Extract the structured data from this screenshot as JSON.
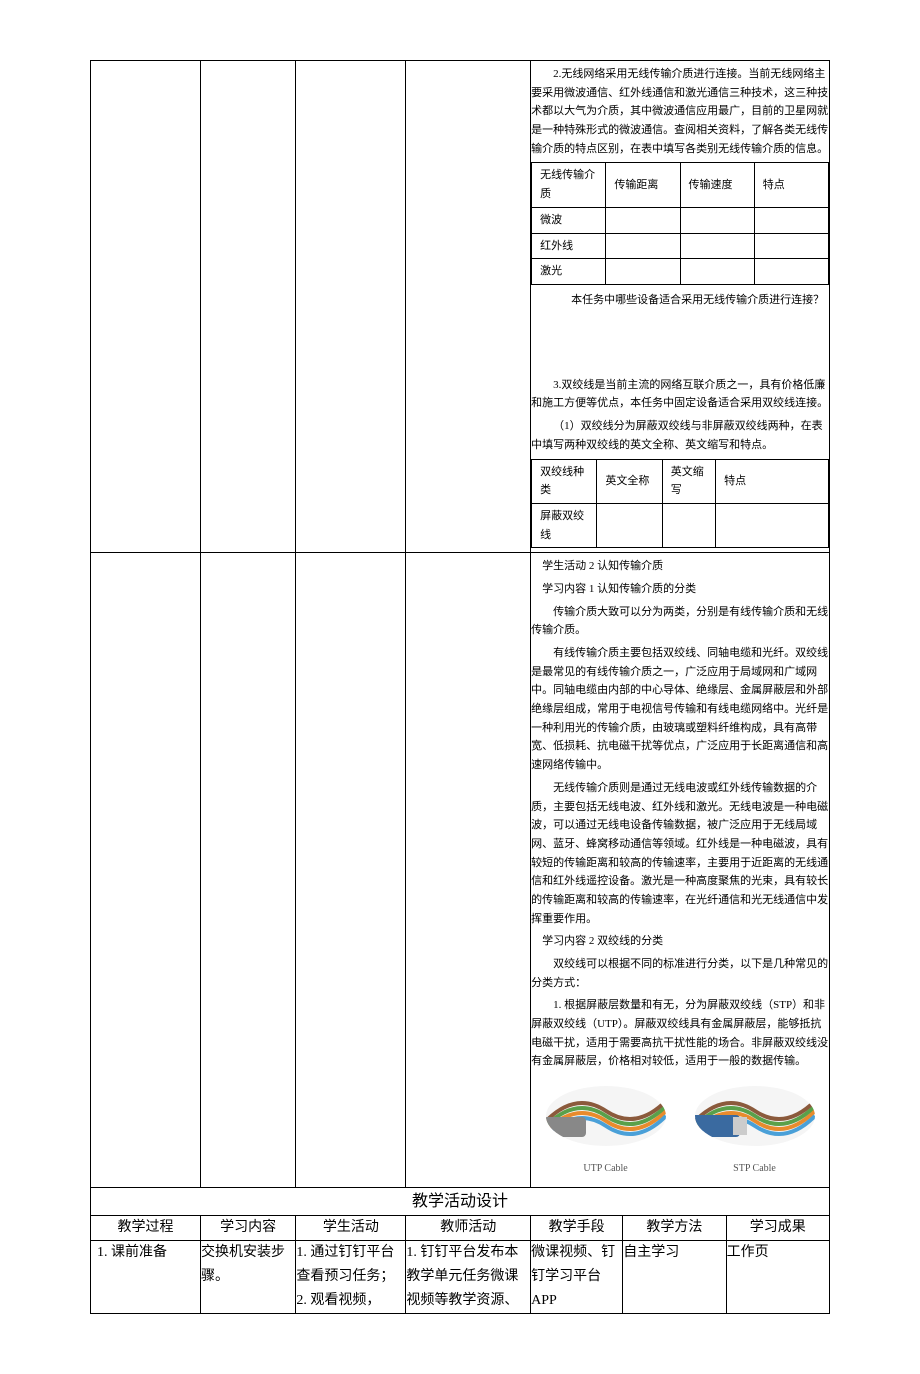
{
  "top": {
    "intro2": "2.无线网络采用无线传输介质进行连接。当前无线网络主要采用微波通信、红外线通信和激光通信三种技术，这三种技术都以大气为介质，其中微波通信应用最广，目前的卫星网就是一种特殊形式的微波通信。查阅相关资料，了解各类无线传输介质的特点区别，在表中填写各类别无线传输介质的信息。",
    "t2h1": "无线传输介质",
    "t2h2": "传输距离",
    "t2h3": "传输速度",
    "t2h4": "特点",
    "t2r1": "微波",
    "t2r2": "红外线",
    "t2r3": "激光",
    "q2": "本任务中哪些设备适合采用无线传输介质进行连接？",
    "intro3": "3.双绞线是当前主流的网络互联介质之一，具有价格低廉和施工方便等优点，本任务中固定设备适合采用双绞线连接。",
    "intro3a": "（1）双绞线分为屏蔽双绞线与非屏蔽双绞线两种，在表中填写两种双绞线的英文全称、英文缩写和特点。",
    "t3h1": "双绞线种类",
    "t3h2": "英文全称",
    "t3h3": "英文缩写",
    "t3h4": "特点",
    "t3r1": "屏蔽双绞线"
  },
  "activity": {
    "title1": "学生活动 2 认知传输介质",
    "title2": "学习内容 1 认知传输介质的分类",
    "p1": "传输介质大致可以分为两类，分别是有线传输介质和无线传输介质。",
    "p2": "有线传输介质主要包括双绞线、同轴电缆和光纤。双绞线是最常见的有线传输介质之一，广泛应用于局域网和广域网中。同轴电缆由内部的中心导体、绝缘层、金属屏蔽层和外部绝缘层组成，常用于电视信号传输和有线电缆网络中。光纤是一种利用光的传输介质，由玻璃或塑料纤维构成，具有高带宽、低损耗、抗电磁干扰等优点，广泛应用于长距离通信和高速网络传输中。",
    "p3": "无线传输介质则是通过无线电波或红外线传输数据的介质，主要包括无线电波、红外线和激光。无线电波是一种电磁波，可以通过无线电设备传输数据，被广泛应用于无线局域网、蓝牙、蜂窝移动通信等领域。红外线是一种电磁波，具有较短的传输距离和较高的传输速率，主要用于近距离的无线通信和红外线遥控设备。激光是一种高度聚焦的光束，具有较长的传输距离和较高的传输速率，在光纤通信和光无线通信中发挥重要作用。",
    "title3": "学习内容 2 双绞线的分类",
    "p4": "双绞线可以根据不同的标准进行分类，以下是几种常见的分类方式：",
    "p5": "1. 根据屏蔽层数量和有无，分为屏蔽双绞线（STP）和非屏蔽双绞线（UTP）。屏蔽双绞线具有金属屏蔽层，能够抵抗电磁干扰，适用于需要高抗干扰性能的场合。非屏蔽双绞线没有金属屏蔽层，价格相对较低，适用于一般的数据传输。",
    "img1": "UTP Cable",
    "img2": "STP Cable"
  },
  "design": {
    "heading": "教学活动设计",
    "h1": "教学过程",
    "h2": "学习内容",
    "h3": "学生活动",
    "h4": "教师活动",
    "h5": "教学手段",
    "h6": "教学方法",
    "h7": "学习成果",
    "r1c1": "1. 课前准备",
    "r1c2": "交换机安装步骤。",
    "r1c3": "1. 通过钉钉平台查看预习任务；\n2. 观看视频，",
    "r1c4": "1. 钉钉平台发布本教学单元任务微课视频等教学资源、",
    "r1c5": "微课视频、钉钉学习平台 APP",
    "r1c6": "自主学习",
    "r1c7": "工作页"
  }
}
